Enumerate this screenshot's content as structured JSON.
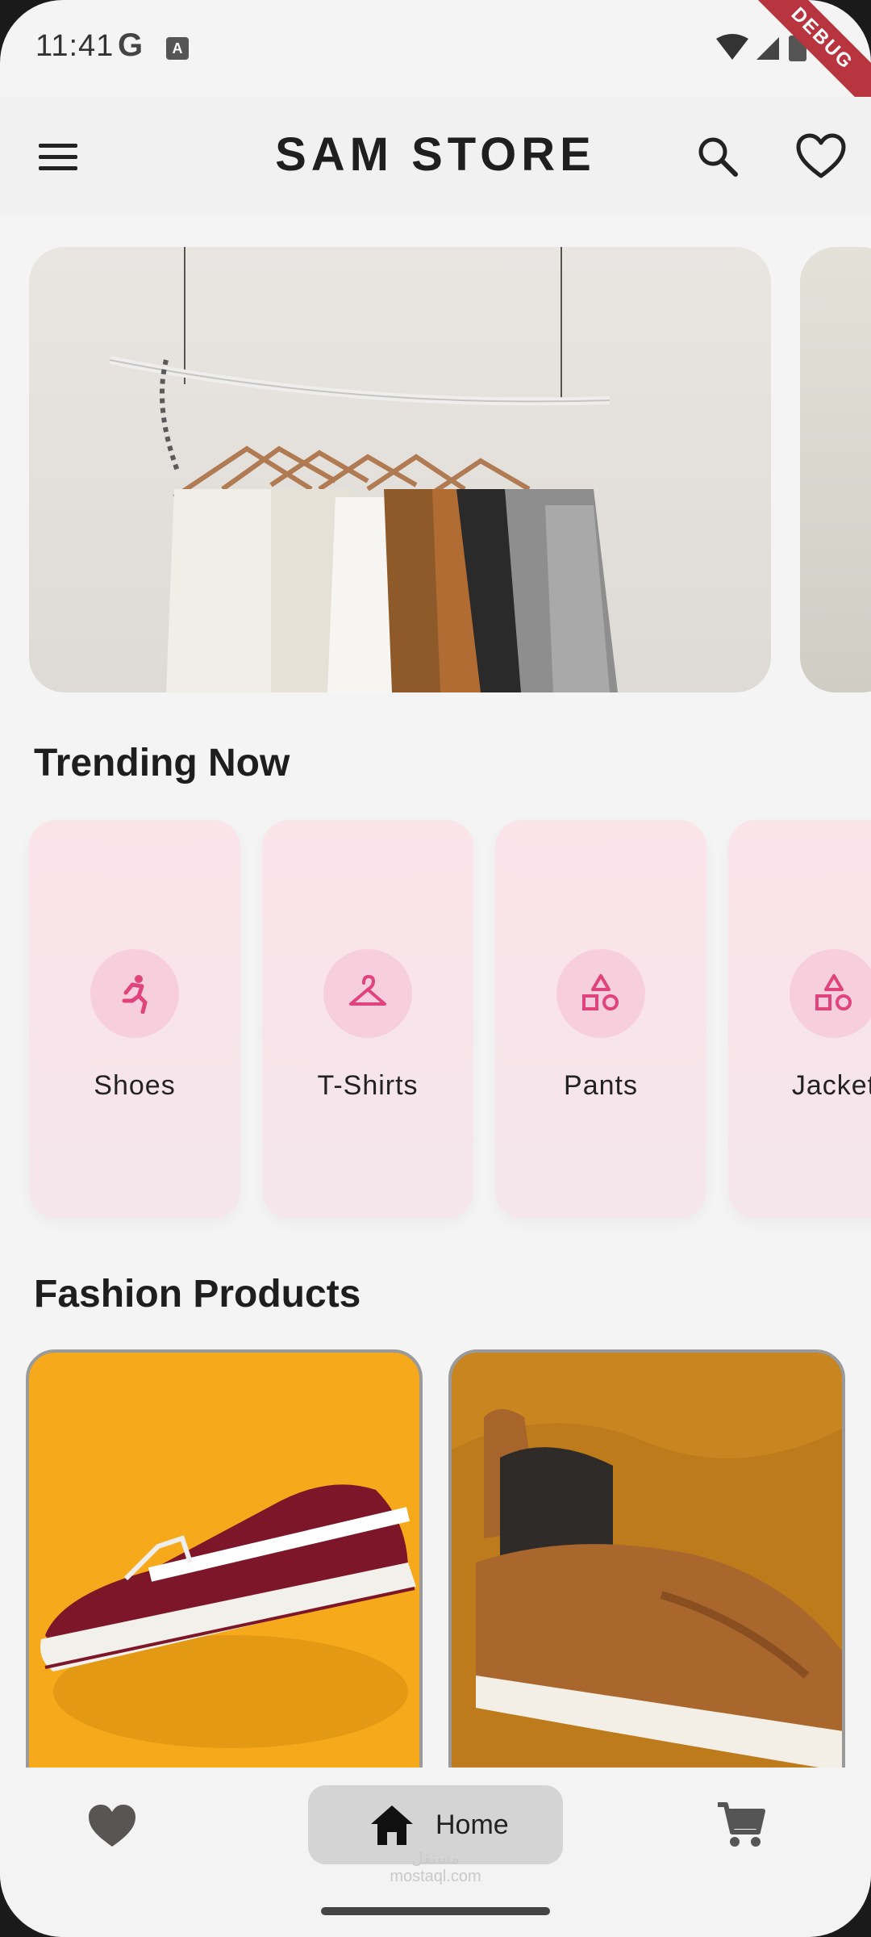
{
  "status_bar": {
    "time": "11:41",
    "g_label": "G",
    "a_label": "A",
    "debug_label": "DEBUG"
  },
  "app_bar": {
    "title": "SAM STORE",
    "menu_icon": "menu-icon",
    "search_icon": "search-icon",
    "favorite_icon": "heart-outline-icon"
  },
  "sections": {
    "trending_title": "Trending Now",
    "fashion_title": "Fashion Products"
  },
  "categories": [
    {
      "label": "Shoes",
      "icon": "running-person-icon"
    },
    {
      "label": "T-Shirts",
      "icon": "hanger-icon"
    },
    {
      "label": "Pants",
      "icon": "shapes-icon"
    },
    {
      "label": "Jacket",
      "icon": "shapes-icon"
    }
  ],
  "products": [
    {
      "image": "maroon-sneaker-on-yellow"
    },
    {
      "image": "brown-sneaker-on-mustard"
    }
  ],
  "bottom_nav": {
    "favorites_icon": "heart-icon",
    "home_label": "Home",
    "home_icon": "home-icon",
    "cart_icon": "cart-icon"
  },
  "watermark": {
    "line1": "مستقل",
    "line2": "mostaql.com"
  },
  "colors": {
    "accent": "#e0447a",
    "category_bg": "#fbe3ea",
    "icon_circle": "#f7cfdc",
    "nav_active": "#d4d4d4"
  }
}
